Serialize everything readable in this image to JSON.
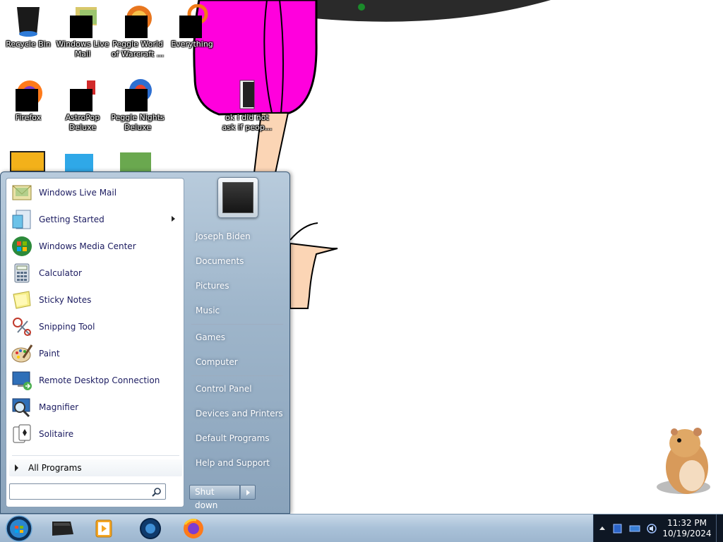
{
  "desktop": {
    "icons": [
      {
        "label": "Recycle Bin"
      },
      {
        "label": "Windows Live Mail"
      },
      {
        "label": "Peggle World of Warcraft ..."
      },
      {
        "label": "Everything"
      },
      {
        "label": "Firefox"
      },
      {
        "label": "AstroPop Deluxe"
      },
      {
        "label": "Peggle Nights Deluxe"
      },
      {
        "label": "ok i did not ask if peop..."
      }
    ]
  },
  "start_menu": {
    "programs": [
      {
        "label": "Windows Live Mail",
        "icon": "mail-icon"
      },
      {
        "label": "Getting Started",
        "icon": "getting-started-icon",
        "has_submenu": true
      },
      {
        "label": "Windows Media Center",
        "icon": "media-center-icon"
      },
      {
        "label": "Calculator",
        "icon": "calculator-icon"
      },
      {
        "label": "Sticky Notes",
        "icon": "sticky-notes-icon"
      },
      {
        "label": "Snipping Tool",
        "icon": "scissors-icon"
      },
      {
        "label": "Paint",
        "icon": "paint-palette-icon"
      },
      {
        "label": "Remote Desktop Connection",
        "icon": "remote-desktop-icon"
      },
      {
        "label": "Magnifier",
        "icon": "magnifier-icon"
      },
      {
        "label": "Solitaire",
        "icon": "cards-icon"
      }
    ],
    "all_programs": "All Programs",
    "search_value": "",
    "places": [
      {
        "label": "Joseph Biden"
      },
      {
        "label": "Documents"
      },
      {
        "label": "Pictures"
      },
      {
        "label": "Music"
      },
      {
        "label": "Games"
      },
      {
        "label": "Computer"
      },
      {
        "label": "Control Panel"
      },
      {
        "label": "Devices and Printers"
      },
      {
        "label": "Default Programs"
      },
      {
        "label": "Help and Support"
      }
    ],
    "shutdown_label": "Shut down"
  },
  "taskbar": {
    "pinned": [
      "explorer-icon",
      "media-player-icon",
      "media-center-icon",
      "firefox-icon"
    ],
    "clock": {
      "time": "11:32 PM",
      "date": "10/19/2024"
    }
  },
  "colors": {
    "taskbar": "#a9c1d8",
    "tray": "#0e1724",
    "menu_text": "#1b1b60",
    "wallpaper_pink": "#ff00dd",
    "wallpaper_skin": "#fbd5b5"
  }
}
